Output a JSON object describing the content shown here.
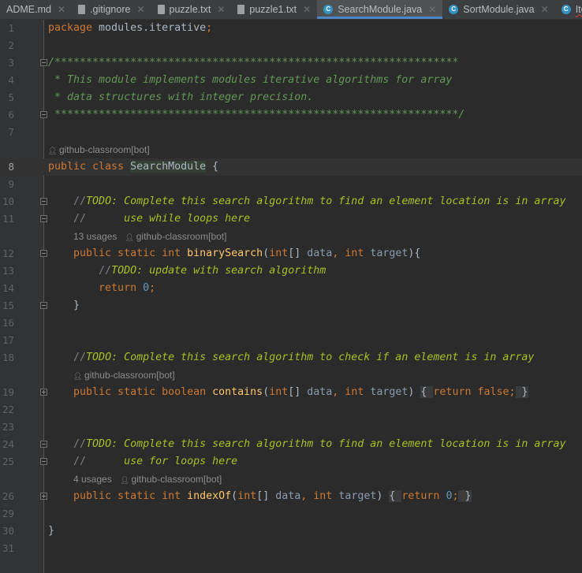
{
  "tabs": [
    {
      "label": "ADME.md",
      "icon": "markdown-file-icon",
      "active": false
    },
    {
      "label": ".gitignore",
      "icon": "ignore-file-icon",
      "active": false
    },
    {
      "label": "puzzle.txt",
      "icon": "text-file-icon",
      "active": false
    },
    {
      "label": "puzzle1.txt",
      "icon": "text-file-icon",
      "active": false
    },
    {
      "label": "SearchModule.java",
      "icon": "java-class-icon",
      "active": true
    },
    {
      "label": "SortModule.java",
      "icon": "java-class-icon",
      "active": false
    },
    {
      "label": "Iterative",
      "icon": "java-class-icon",
      "active": false,
      "error": true
    }
  ],
  "colors": {
    "keyword": "#cc7832",
    "method": "#ffc66d",
    "number": "#6897bb",
    "todo": "#a8c023",
    "doc": "#629755",
    "accent": "#4a88c7"
  },
  "rows": [
    {
      "ln": "1",
      "tokens": [
        [
          "k",
          "package "
        ],
        [
          "i",
          "modules.iterative"
        ],
        [
          "k",
          ";"
        ]
      ]
    },
    {
      "ln": "2",
      "tokens": []
    },
    {
      "ln": "3",
      "fold": "start",
      "tokens": [
        [
          "d",
          "/****************************************************************"
        ]
      ]
    },
    {
      "ln": "4",
      "tokens": [
        [
          "d",
          " * This module implements modules iterative algorithms for array"
        ]
      ]
    },
    {
      "ln": "5",
      "tokens": [
        [
          "d",
          " * data structures with integer precision."
        ]
      ]
    },
    {
      "ln": "6",
      "fold": "end",
      "tokens": [
        [
          "d",
          " ****************************************************************/"
        ]
      ]
    },
    {
      "ln": "7",
      "tokens": []
    },
    {
      "inlay": "github-classroom[bot]",
      "indent": 0
    },
    {
      "ln": "8",
      "current": true,
      "tokens": [
        [
          "k",
          "public class "
        ],
        [
          "cl",
          "SearchModule"
        ],
        [
          "i",
          " {"
        ]
      ]
    },
    {
      "ln": "9",
      "tokens": []
    },
    {
      "ln": "10",
      "fold": "start",
      "tokens": [
        [
          "c",
          "    //"
        ],
        [
          "t",
          "TODO: Complete this search algorithm to find an element location is in array"
        ]
      ]
    },
    {
      "ln": "11",
      "fold": "end",
      "tokens": [
        [
          "c",
          "    //      "
        ],
        [
          "t",
          "use while loops here"
        ]
      ]
    },
    {
      "inlay": "github-classroom[bot]",
      "usages": "13 usages",
      "indent": 4
    },
    {
      "ln": "12",
      "fold": "start",
      "tokens": [
        [
          "k",
          "    public static int "
        ],
        [
          "m",
          "binarySearch"
        ],
        [
          "i",
          "("
        ],
        [
          "k",
          "int"
        ],
        [
          "i",
          "[] "
        ],
        [
          "p",
          "data"
        ],
        [
          "k",
          ", int "
        ],
        [
          "p",
          "target"
        ],
        [
          "i",
          "){"
        ]
      ]
    },
    {
      "ln": "13",
      "tokens": [
        [
          "c",
          "        //"
        ],
        [
          "t",
          "TODO: update with search algorithm"
        ]
      ]
    },
    {
      "ln": "14",
      "tokens": [
        [
          "k",
          "        return "
        ],
        [
          "n",
          "0"
        ],
        [
          "k",
          ";"
        ]
      ]
    },
    {
      "ln": "15",
      "fold": "end",
      "tokens": [
        [
          "i",
          "    }"
        ]
      ]
    },
    {
      "ln": "16",
      "tokens": []
    },
    {
      "ln": "17",
      "tokens": []
    },
    {
      "ln": "18",
      "tokens": [
        [
          "c",
          "    //"
        ],
        [
          "t",
          "TODO: Complete this search algorithm to check if an element is in array"
        ]
      ]
    },
    {
      "inlay": "github-classroom[bot]",
      "indent": 4
    },
    {
      "ln": "19",
      "fold": "plus",
      "tokens": [
        [
          "k",
          "    public static boolean "
        ],
        [
          "m",
          "contains"
        ],
        [
          "i",
          "("
        ],
        [
          "k",
          "int"
        ],
        [
          "i",
          "[] "
        ],
        [
          "p",
          "data"
        ],
        [
          "k",
          ", int "
        ],
        [
          "p",
          "target"
        ],
        [
          "i",
          ") "
        ],
        [
          "f",
          "{ "
        ],
        [
          "k",
          "return false;"
        ],
        [
          "f",
          " }"
        ]
      ]
    },
    {
      "ln": "22",
      "tokens": []
    },
    {
      "ln": "23",
      "tokens": []
    },
    {
      "ln": "24",
      "fold": "start",
      "tokens": [
        [
          "c",
          "    //"
        ],
        [
          "t",
          "TODO: Complete this search algorithm to find an element location is in array"
        ]
      ]
    },
    {
      "ln": "25",
      "fold": "end",
      "tokens": [
        [
          "c",
          "    //      "
        ],
        [
          "t",
          "use for loops here"
        ]
      ]
    },
    {
      "inlay": "github-classroom[bot]",
      "usages": "4 usages",
      "indent": 4
    },
    {
      "ln": "26",
      "fold": "plus",
      "tokens": [
        [
          "k",
          "    public static int "
        ],
        [
          "m",
          "indexOf"
        ],
        [
          "i",
          "("
        ],
        [
          "k",
          "int"
        ],
        [
          "i",
          "[] "
        ],
        [
          "p",
          "data"
        ],
        [
          "k",
          ", int "
        ],
        [
          "p",
          "target"
        ],
        [
          "i",
          ") "
        ],
        [
          "f",
          "{ "
        ],
        [
          "k",
          "return "
        ],
        [
          "n",
          "0"
        ],
        [
          "k",
          ";"
        ],
        [
          "f",
          " }"
        ]
      ]
    },
    {
      "ln": "29",
      "tokens": []
    },
    {
      "ln": "30",
      "tokens": [
        [
          "i",
          "}"
        ]
      ]
    },
    {
      "ln": "31",
      "tokens": []
    }
  ]
}
